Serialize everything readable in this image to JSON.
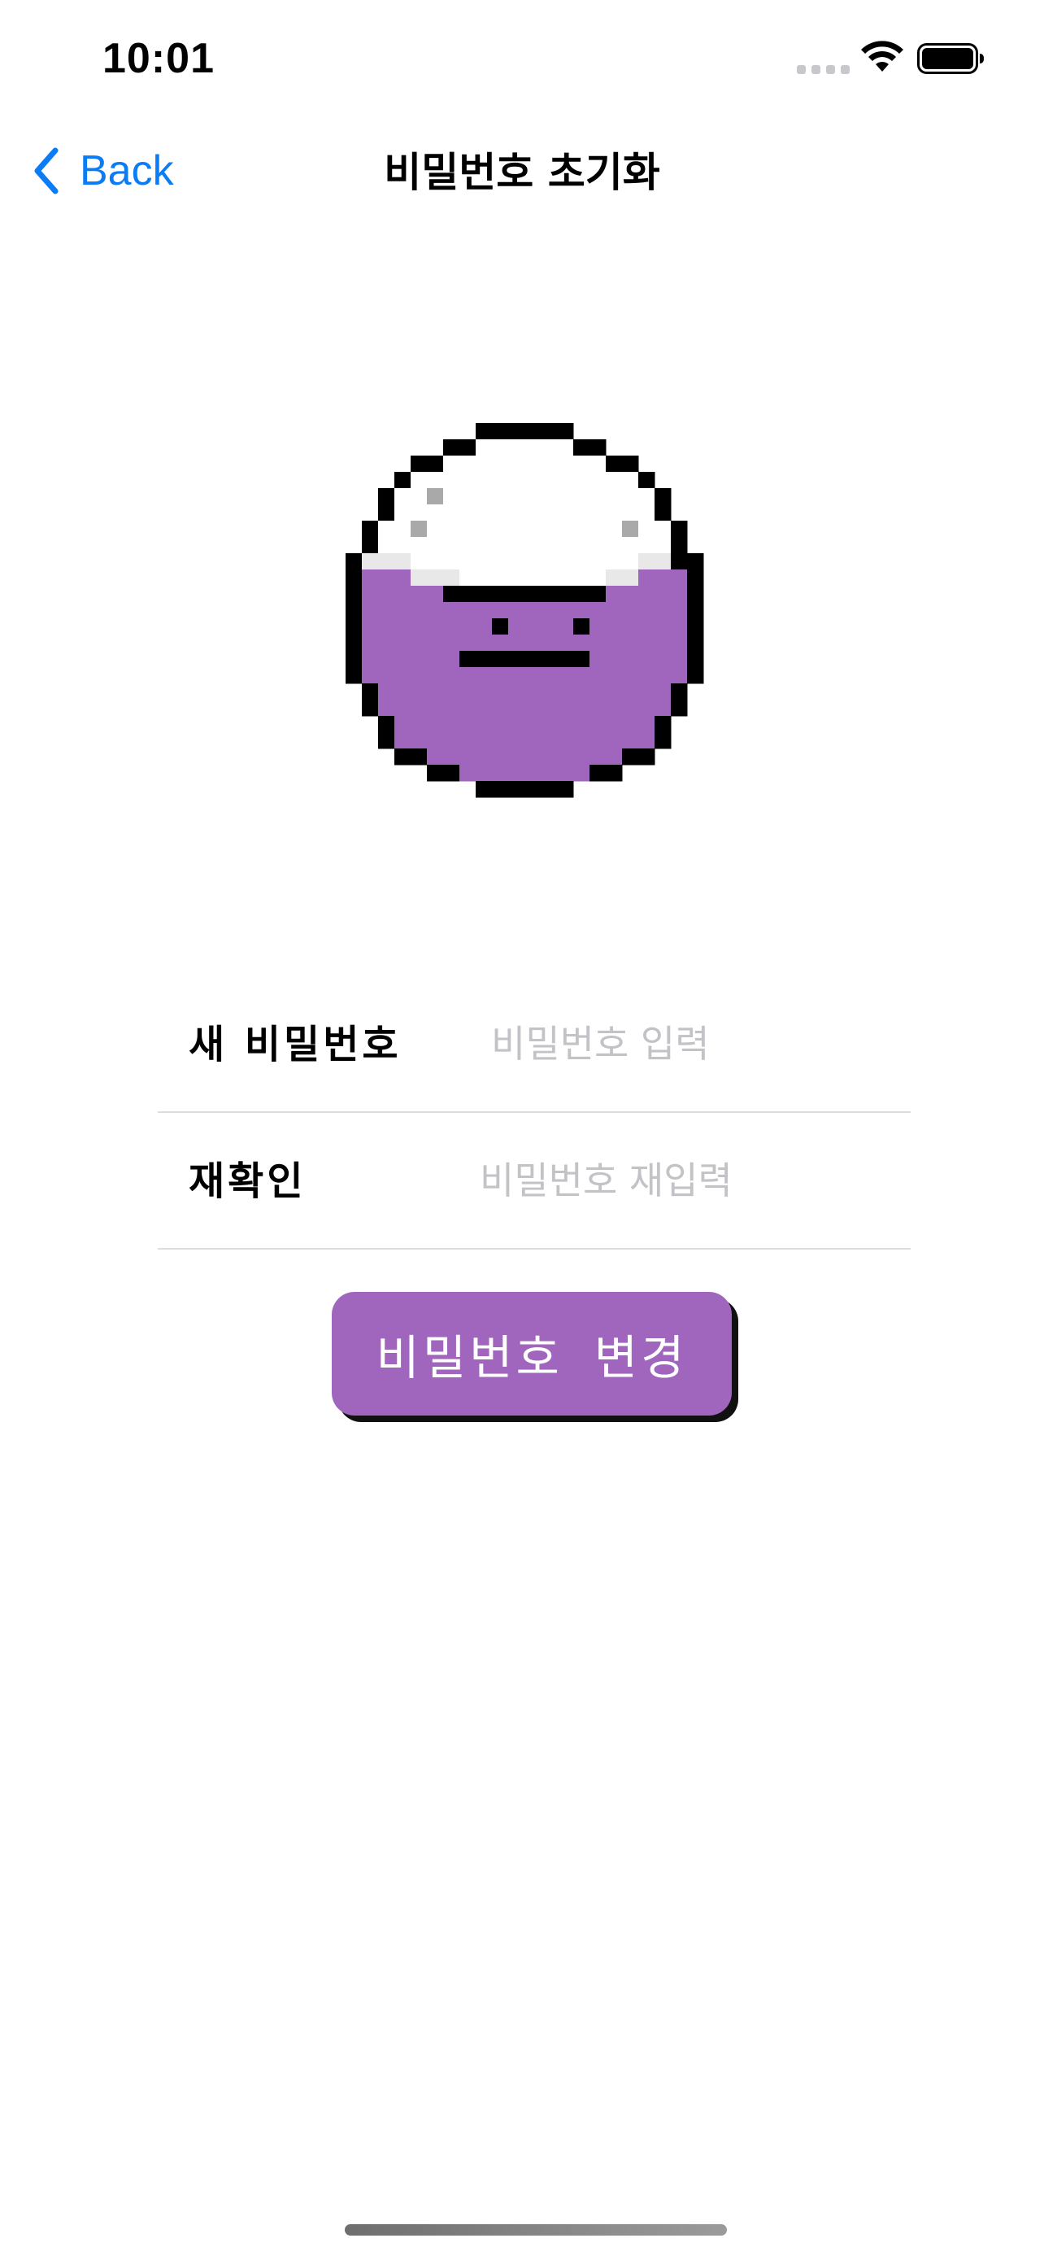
{
  "status_bar": {
    "time": "10:01",
    "signal_icon": "cellular-dots-icon",
    "wifi_icon": "wifi-icon",
    "battery_icon": "battery-icon"
  },
  "nav": {
    "back_label": "Back",
    "back_icon": "chevron-left-icon",
    "title": "비밀번호 초기화"
  },
  "mascot": {
    "icon": "rice-bowl-mascot-icon",
    "colors": {
      "bowl": "#a066bd",
      "rice": "#ffffff",
      "rice_shade": "#e8e8e8",
      "rice_grain": "#a9a9a9",
      "outline": "#000000"
    }
  },
  "form": {
    "new_password": {
      "label": "새 비밀번호",
      "value": "",
      "placeholder": "비밀번호 입력"
    },
    "confirm_password": {
      "label": "재확인",
      "value": "",
      "placeholder": "비밀번호 재입력"
    }
  },
  "submit": {
    "label": "비밀번호 변경"
  },
  "colors": {
    "accent": "#a066bd",
    "link": "#0a7cf5",
    "placeholder": "#c2c2c7",
    "divider": "#dcdcdc"
  }
}
